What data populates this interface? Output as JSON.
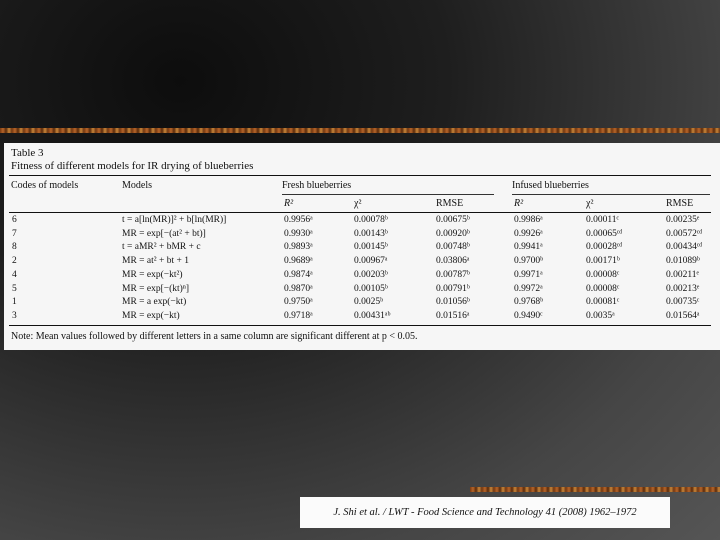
{
  "table": {
    "title": "Table 3",
    "subtitle": "Fitness of different models for IR drying of blueberries",
    "headers": {
      "codes": "Codes of models",
      "models": "Models",
      "fresh": "Fresh blueberries",
      "infused": "Infused blueberries",
      "r2": "R²",
      "chi2": "χ²",
      "rmse": "RMSE"
    },
    "rows": [
      {
        "code": "6",
        "model": "t = a[ln(MR)]² + b[ln(MR)]",
        "fr2": "0.9956ᵃ",
        "fchi": "0.00078ᵇ",
        "frmse": "0.00675ᵇ",
        "ir2": "0.9986ᵃ",
        "ichi": "0.00011ᶜ",
        "irmse": "0.00235ᵉ"
      },
      {
        "code": "7",
        "model": "MR = exp[−(at² + bt)]",
        "fr2": "0.9930ᵃ",
        "fchi": "0.00143ᵇ",
        "frmse": "0.00920ᵇ",
        "ir2": "0.9926ᵃ",
        "ichi": "0.00065ᶜᵈ",
        "irmse": "0.00572ᶜᵈ"
      },
      {
        "code": "8",
        "model": "t = aMR² + bMR + c",
        "fr2": "0.9893ᵃ",
        "fchi": "0.00145ᵇ",
        "frmse": "0.00748ᵇ",
        "ir2": "0.9941ᵃ",
        "ichi": "0.00028ᶜᵈ",
        "irmse": "0.00434ᶜᵈ"
      },
      {
        "code": "2",
        "model": "MR = at² + bt + 1",
        "fr2": "0.9689ᵃ",
        "fchi": "0.00967ᵃ",
        "frmse": "0.03806ᵃ",
        "ir2": "0.9700ᵇ",
        "ichi": "0.00171ᵇ",
        "irmse": "0.01089ᵇ"
      },
      {
        "code": "4",
        "model": "MR = exp(−kt²)",
        "fr2": "0.9874ᵃ",
        "fchi": "0.00203ᵇ",
        "frmse": "0.00787ᵇ",
        "ir2": "0.9971ᵃ",
        "ichi": "0.00008ᶜ",
        "irmse": "0.00211ᵉ"
      },
      {
        "code": "5",
        "model": "MR = exp[−(kt)ⁿ]",
        "fr2": "0.9870ᵃ",
        "fchi": "0.00105ᵇ",
        "frmse": "0.00791ᵇ",
        "ir2": "0.9972ᵃ",
        "ichi": "0.00008ᶜ",
        "irmse": "0.00213ᵉ"
      },
      {
        "code": "1",
        "model": "MR = a exp(−kt)",
        "fr2": "0.9750ᵃ",
        "fchi": "0.0025ᵇ",
        "frmse": "0.01056ᵇ",
        "ir2": "0.9768ᵇ",
        "ichi": "0.00081ᶜ",
        "irmse": "0.00735ᶜ"
      },
      {
        "code": "3",
        "model": "MR = exp(−kt)",
        "fr2": "0.9718ᵃ",
        "fchi": "0.00431ᵃᵇ",
        "frmse": "0.01516ᵃ",
        "ir2": "0.9490ᶜ",
        "ichi": "0.0035ᵃ",
        "irmse": "0.01564ᵃ"
      }
    ],
    "note": "Note: Mean values followed by different letters in a same column are significant different at p < 0.05."
  },
  "citation": "J. Shi et al. / LWT - Food Science and Technology 41 (2008) 1962–1972"
}
